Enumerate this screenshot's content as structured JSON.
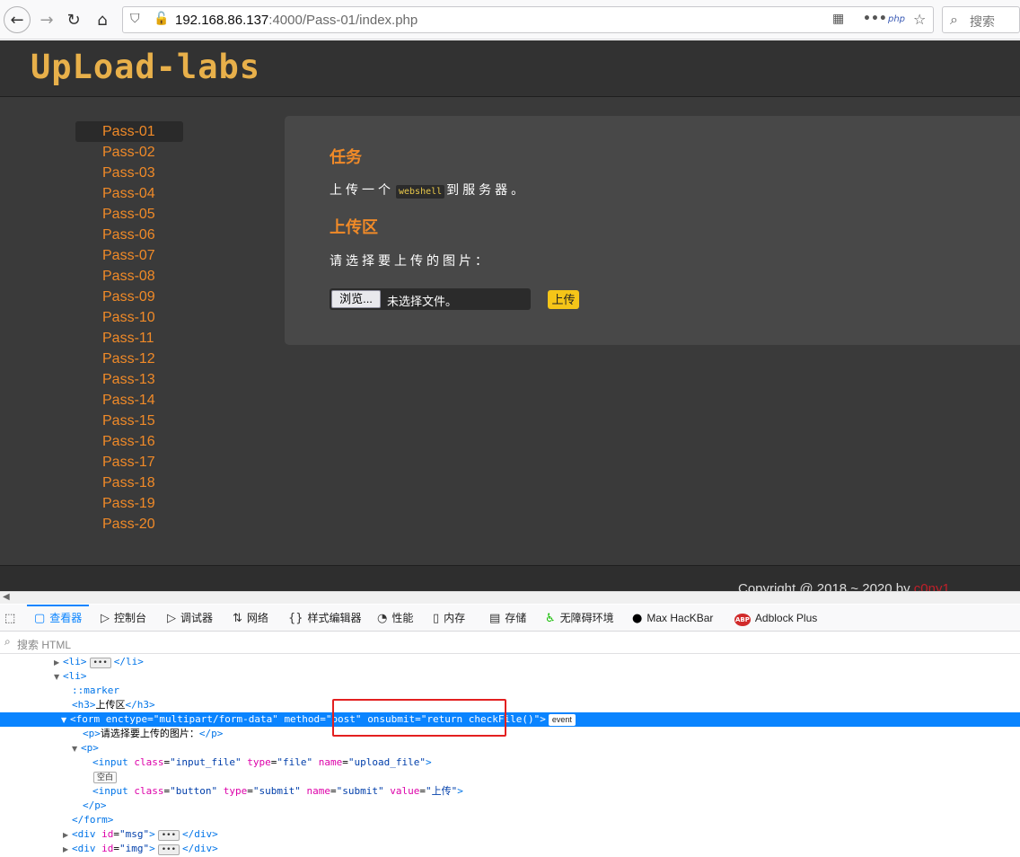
{
  "browser": {
    "url_host": "192.168.86.137",
    "url_rest": ":4000/Pass-01/index.php",
    "search_placeholder": "搜索",
    "php_badge": "php"
  },
  "site": {
    "logo": "UpLoad-labs",
    "sidebar": [
      "Pass-01",
      "Pass-02",
      "Pass-03",
      "Pass-04",
      "Pass-05",
      "Pass-06",
      "Pass-07",
      "Pass-08",
      "Pass-09",
      "Pass-10",
      "Pass-11",
      "Pass-12",
      "Pass-13",
      "Pass-14",
      "Pass-15",
      "Pass-16",
      "Pass-17",
      "Pass-18",
      "Pass-19",
      "Pass-20"
    ],
    "task_heading": "任务",
    "task_before": "上传一个",
    "task_code": "webshell",
    "task_after": "到服务器。",
    "upload_heading": "上传区",
    "upload_prompt": "请选择要上传的图片：",
    "browse_label": "浏览...",
    "no_file": "未选择文件。",
    "submit_label": "上传",
    "footer_prefix": "Copyright @ 2018 ~ 2020 by ",
    "footer_author": "c0ny1"
  },
  "devtools": {
    "tabs": [
      {
        "icon": "▢",
        "label": "查看器"
      },
      {
        "icon": "▷",
        "label": "控制台"
      },
      {
        "icon": "▷",
        "label": "调试器"
      },
      {
        "icon": "⇅",
        "label": "网络"
      },
      {
        "icon": "{}",
        "label": "样式编辑器"
      },
      {
        "icon": "◔",
        "label": "性能"
      },
      {
        "icon": "▯",
        "label": "内存"
      },
      {
        "icon": "▤",
        "label": "存储"
      },
      {
        "icon": "♿",
        "label": "无障碍环境"
      },
      {
        "icon": "●",
        "label": "Max HacKBar"
      },
      {
        "icon": "ABP",
        "label": "Adblock Plus"
      }
    ],
    "search_placeholder": "搜索 HTML",
    "dom": {
      "li1_open": "<li>",
      "li1_close": "</li>",
      "li2_open": "<li>",
      "marker": "::marker",
      "h3_open": "<h3>",
      "h3_text": "上传区",
      "h3_close": "</h3>",
      "form_tag": "<form",
      "enctype_name": "enctype",
      "enctype_value": "\"multipart/form-data\"",
      "method_name": "method",
      "method_value": "\"post\"",
      "onsubmit_name": "onsubmit",
      "onsubmit_value": "\"return checkFile()\"",
      "form_end": ">",
      "event_badge": "event",
      "p1_open": "<p>",
      "p1_text": "请选择要上传的图片：",
      "p1_close": "</p>",
      "p2_open": "<p>",
      "input1_tag": "<input",
      "class_name": "class",
      "input1_class": "\"input_file\"",
      "type_name": "type",
      "input1_type": "\"file\"",
      "name_name": "name",
      "input1_name": "\"upload_file\"",
      "whitespace_badge": "空白",
      "input2_tag": "<input",
      "input2_class": "\"button\"",
      "input2_type": "\"submit\"",
      "input2_name": "\"submit\"",
      "value_name": "value",
      "input2_value": "\"上传\"",
      "p2_close": "</p>",
      "form_close": "</form>",
      "div_msg_open": "<div",
      "id_name": "id",
      "div_msg_id": "\"msg\"",
      "div_msg_close": "</div>",
      "div_img_open": "<div",
      "div_img_id": "\"img\"",
      "div_img_close": "</div>",
      "ellipsis": "•••",
      "equals": "=",
      "gt": ">"
    }
  }
}
